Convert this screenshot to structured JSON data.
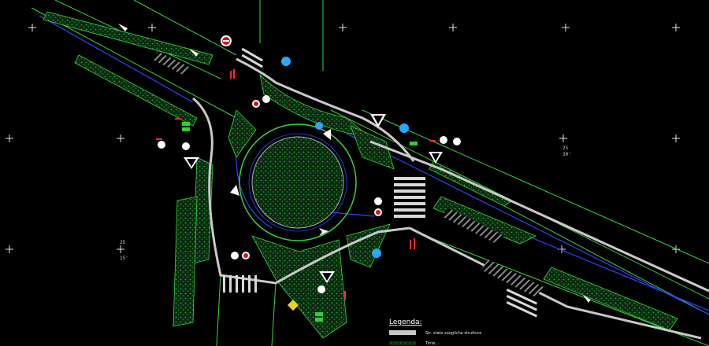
{
  "legend": {
    "title": "Legenda:",
    "items": [
      {
        "label": "Str. stato zoogliche strutture"
      },
      {
        "label": "Tinte..."
      }
    ]
  },
  "dimensions": [
    "25",
    "30'",
    "25",
    "15'"
  ],
  "colors": {
    "background": "#000000",
    "vegetation": "#1f8f2a",
    "curb": "#c9c9c9",
    "blue_line": "#2d43ff",
    "green_outline": "#35d63a",
    "red_marks": "#ff2a2a",
    "sign_yellow": "#e8d12a"
  }
}
